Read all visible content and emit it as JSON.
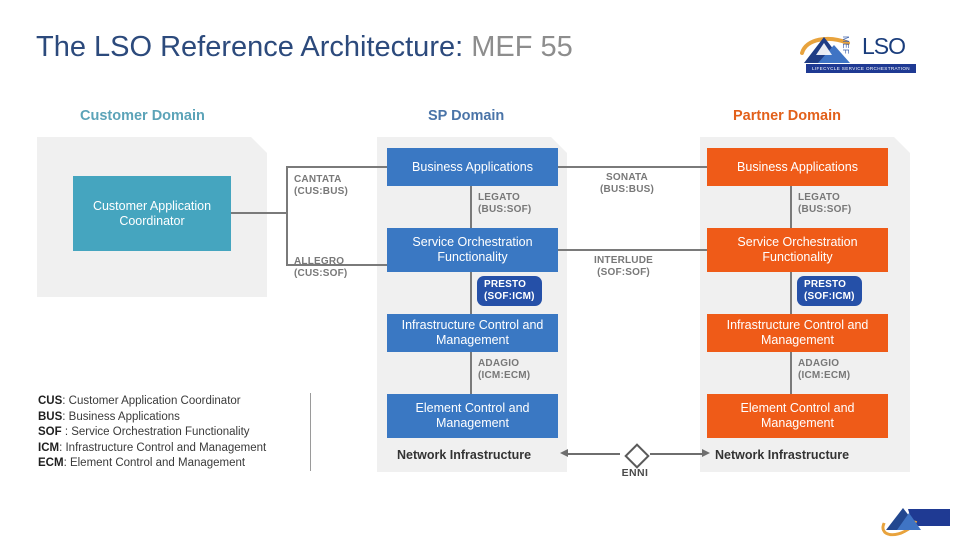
{
  "title": {
    "main": "The LSO Reference Architecture:",
    "sub": "MEF 55"
  },
  "logo": {
    "lso": "LSO",
    "mef": "MEF",
    "tagline": "LIFECYCLE SERVICE ORCHESTRATION"
  },
  "domains": {
    "customer": "Customer Domain",
    "sp": "SP Domain",
    "partner": "Partner Domain"
  },
  "customer": {
    "coordinator": "Customer Application Coordinator",
    "cantata": "CANTATA",
    "cantata_pair": "(CUS:BUS)",
    "allegro": "ALLEGRO",
    "allegro_pair": "(CUS:SOF)"
  },
  "sp": {
    "business_applications": "Business Applications",
    "service_orchestration": "Service Orchestration Functionality",
    "infrastructure_control": "Infrastructure Control and Management",
    "element_control": "Element Control and Management",
    "network_infrastructure": "Network Infrastructure",
    "legato": "LEGATO",
    "legato_pair": "(BUS:SOF)",
    "presto": "PRESTO",
    "presto_pair": "(SOF:ICM)",
    "adagio": "ADAGIO",
    "adagio_pair": "(ICM:ECM)"
  },
  "partner": {
    "business_applications": "Business Applications",
    "service_orchestration": "Service Orchestration Functionality",
    "infrastructure_control": "Infrastructure Control and Management",
    "element_control": "Element Control and Management",
    "network_infrastructure": "Network Infrastructure",
    "legato": "LEGATO",
    "legato_pair": "(BUS:SOF)",
    "presto": "PRESTO",
    "presto_pair": "(SOF:ICM)",
    "adagio": "ADAGIO",
    "adagio_pair": "(ICM:ECM)"
  },
  "inter_domain": {
    "sonata": "SONATA",
    "sonata_pair": "(BUS:BUS)",
    "interlude": "INTERLUDE",
    "interlude_pair": "(SOF:SOF)",
    "enni": "ENNI"
  },
  "legend": [
    {
      "abbr": "CUS",
      "sep": ": ",
      "text": "Customer Application Coordinator"
    },
    {
      "abbr": "BUS",
      "sep": ": ",
      "text": "Business Applications"
    },
    {
      "abbr": "SOF",
      "sep": " : ",
      "text": "Service Orchestration Functionality"
    },
    {
      "abbr": "ICM",
      "sep": ": ",
      "text": "Infrastructure Control and Management"
    },
    {
      "abbr": "ECM",
      "sep": ": ",
      "text": "Element Control and Management"
    }
  ],
  "colors": {
    "title_main": "#2c4a7c",
    "title_sub": "#8d8d8d",
    "customer_domain": "#5ba3b8",
    "sp_domain": "#4a74a8",
    "partner_domain": "#e2601a",
    "teal_box": "#45a5bf",
    "blue_box": "#3a78c3",
    "orange_box": "#ef5b18",
    "presto_pill": "#2550a8",
    "panel_bg": "#f0f0f0",
    "connector": "#7a7a7a"
  }
}
